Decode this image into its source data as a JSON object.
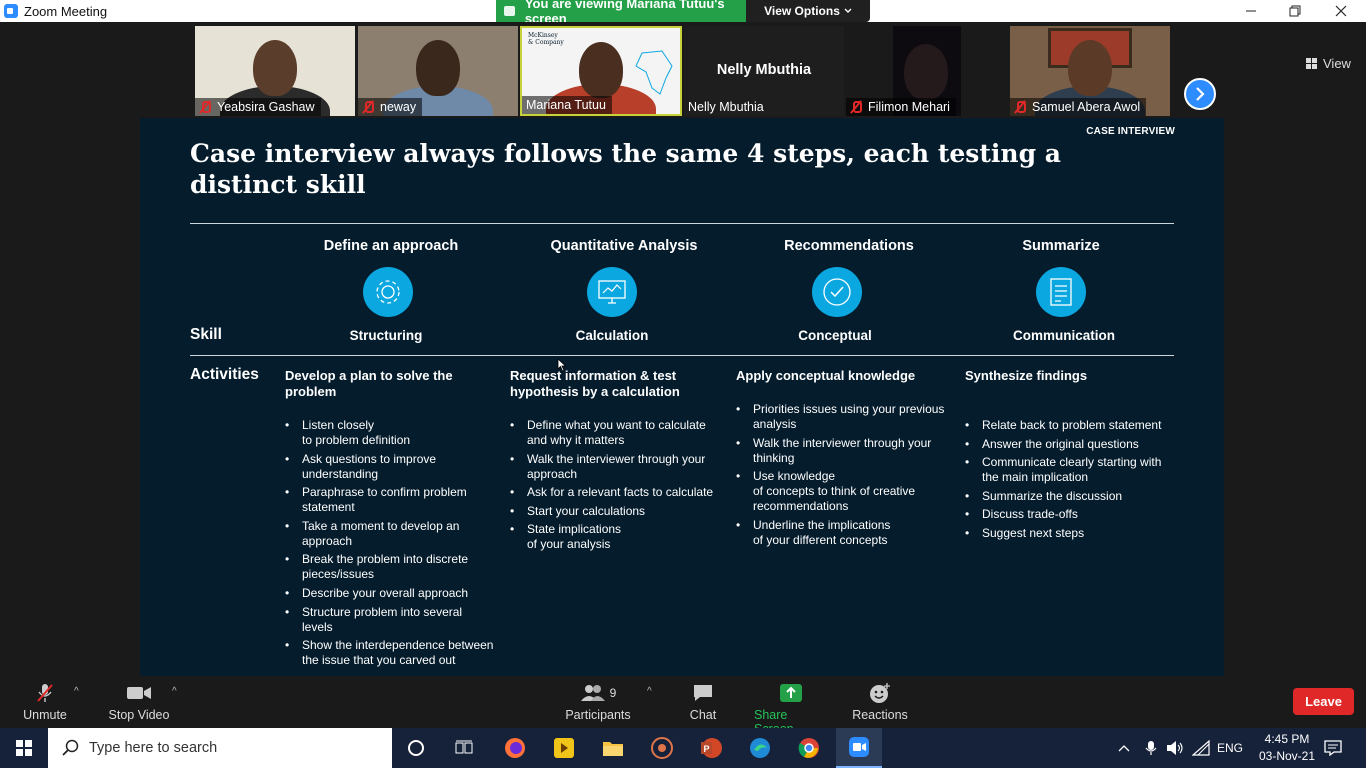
{
  "window": {
    "title": "Zoom Meeting",
    "share_banner": "You are viewing Mariana Tutuu's screen",
    "view_options": "View Options"
  },
  "participants_strip": {
    "tiles": [
      {
        "name": "Yeabsira Gashaw",
        "muted": true
      },
      {
        "name": "neway",
        "muted": true
      },
      {
        "name": "Mariana Tutuu",
        "muted": false,
        "active_speaker": true
      },
      {
        "name": "Nelly Mbuthia",
        "muted": false,
        "video_off": true,
        "display": "Nelly Mbuthia"
      },
      {
        "name": "Filimon Mehari",
        "muted": true
      },
      {
        "name": "Samuel Abera Awol",
        "muted": true
      }
    ],
    "view_label": "View",
    "tile_logo": "McKinsey\n& Company"
  },
  "slide": {
    "tag": "CASE INTERVIEW",
    "headline": "Case interview always follows the same 4 steps, each testing a distinct skill",
    "row_labels": {
      "skill": "Skill",
      "activities": "Activities"
    },
    "steps": [
      {
        "heading": "Define an approach",
        "icon": "gear-icon",
        "skill": "Structuring",
        "activity_title": "Develop a plan to solve the problem",
        "items": [
          "Listen closely\nto problem definition",
          "Ask questions to improve understanding",
          "Paraphrase to confirm problem statement",
          "Take a moment to develop an approach",
          "Break the problem into discrete pieces/issues",
          "Describe your overall approach",
          "Structure problem into several levels",
          "Show the interdependence between the issue that you carved out"
        ]
      },
      {
        "heading": "Quantitative Analysis",
        "icon": "monitor-chart-icon",
        "skill": "Calculation",
        "activity_title": "Request information & test hypothesis by a calculation",
        "items": [
          "Define what you want to calculate and why it matters",
          "Walk the interviewer through your approach",
          "Ask for a relevant facts to calculate",
          "Start your calculations",
          "State implications\nof your analysis"
        ]
      },
      {
        "heading": "Recommendations",
        "icon": "checkmark-icon",
        "skill": "Conceptual",
        "activity_title": "Apply conceptual knowledge",
        "items": [
          "Priorities issues using your previous analysis",
          "Walk the interviewer through your thinking",
          "Use knowledge\nof concepts to think of creative recommendations",
          "Underline the implications\nof your different concepts"
        ]
      },
      {
        "heading": "Summarize",
        "icon": "document-list-icon",
        "skill": "Communication",
        "activity_title": "Synthesize findings",
        "items": [
          "Relate back to problem statement",
          "Answer the original questions",
          "Communicate clearly starting with the main implication",
          "Summarize the discussion",
          "Discuss trade-offs",
          "Suggest next steps"
        ]
      }
    ]
  },
  "toolbar": {
    "unmute": "Unmute",
    "stop_video": "Stop Video",
    "participants": "Participants",
    "participants_count": "9",
    "chat": "Chat",
    "share_screen": "Share Screen",
    "reactions": "Reactions",
    "leave": "Leave"
  },
  "taskbar": {
    "search_placeholder": "Type here to search",
    "language": "ENG",
    "time": "4:45 PM",
    "date": "03-Nov-21"
  },
  "colors": {
    "slide_bg": "#051c2c",
    "icon_blue": "#0ba7e0",
    "banner_green": "#24a148",
    "leave_red": "#e02828",
    "zoom_blue": "#2d8cff"
  }
}
